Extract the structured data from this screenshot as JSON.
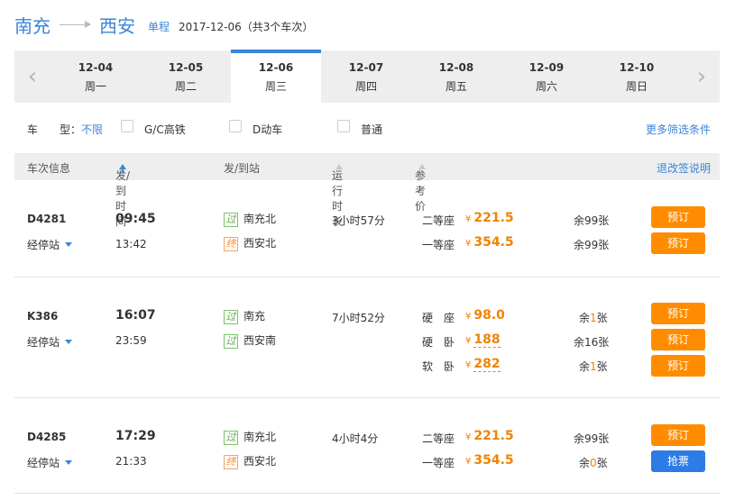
{
  "route": {
    "from": "南充",
    "to": "西安",
    "trip_type": "单程",
    "info": "2017-12-06（共3个车次）"
  },
  "dates": [
    {
      "date": "12-04",
      "weekday": "周一"
    },
    {
      "date": "12-05",
      "weekday": "周二"
    },
    {
      "date": "12-06",
      "weekday": "周三",
      "active": true
    },
    {
      "date": "12-07",
      "weekday": "周四"
    },
    {
      "date": "12-08",
      "weekday": "周五"
    },
    {
      "date": "12-09",
      "weekday": "周六"
    },
    {
      "date": "12-10",
      "weekday": "周日"
    }
  ],
  "filter": {
    "label": "车　　型：",
    "all": "不限",
    "options": [
      "G/C高铁",
      "D动车",
      "普通"
    ],
    "more": "更多筛选条件"
  },
  "header": {
    "train": "车次信息",
    "time": "发/到时间",
    "station": "发/到站",
    "duration": "运行时长",
    "price": "参考价",
    "refund": "退改签说明"
  },
  "trains": [
    {
      "code": "D4281",
      "stops": "经停站",
      "depart": "09:45",
      "arrive": "13:42",
      "from_tag": "过",
      "from": "南充北",
      "to_tag": "终",
      "to": "西安北",
      "duration": "3小时57分",
      "seats": [
        {
          "type": "二等座",
          "yen": "¥",
          "price": "221.5",
          "left_pre": "余",
          "left_num": "99",
          "left_suf": "张",
          "action": "预订"
        },
        {
          "type": "一等座",
          "yen": "¥",
          "price": "354.5",
          "left_pre": "余",
          "left_num": "99",
          "left_suf": "张",
          "action": "预订"
        }
      ]
    },
    {
      "code": "K386",
      "stops": "经停站",
      "depart": "16:07",
      "arrive": "23:59",
      "from_tag": "过",
      "from": "南充",
      "to_tag": "过",
      "to": "西安南",
      "duration": "7小时52分",
      "seats": [
        {
          "type": "硬　座",
          "yen": "¥",
          "price": "98.0",
          "left_pre": "余",
          "left_num": "1",
          "left_suf": "张",
          "action": "预订"
        },
        {
          "type": "硬　卧",
          "yen": "¥",
          "price": "188",
          "left_pre": "余",
          "left_num": "16",
          "left_suf": "张",
          "action": "预订"
        },
        {
          "type": "软　卧",
          "yen": "¥",
          "price": "282",
          "left_pre": "余",
          "left_num": "1",
          "left_suf": "张",
          "action": "预订"
        }
      ]
    },
    {
      "code": "D4285",
      "stops": "经停站",
      "depart": "17:29",
      "arrive": "21:33",
      "from_tag": "过",
      "from": "南充北",
      "to_tag": "终",
      "to": "西安北",
      "duration": "4小时4分",
      "seats": [
        {
          "type": "二等座",
          "yen": "¥",
          "price": "221.5",
          "left_pre": "余",
          "left_num": "99",
          "left_suf": "张",
          "action": "预订"
        },
        {
          "type": "一等座",
          "yen": "¥",
          "price": "354.5",
          "left_pre": "余",
          "left_num": "0",
          "left_suf": "张",
          "action": "抢票"
        }
      ]
    }
  ],
  "colors": {
    "accent": "#3a86d8",
    "orange": "#ff8c00",
    "grab_blue": "#2d7be5",
    "bar_grey": "#eeeeee"
  }
}
